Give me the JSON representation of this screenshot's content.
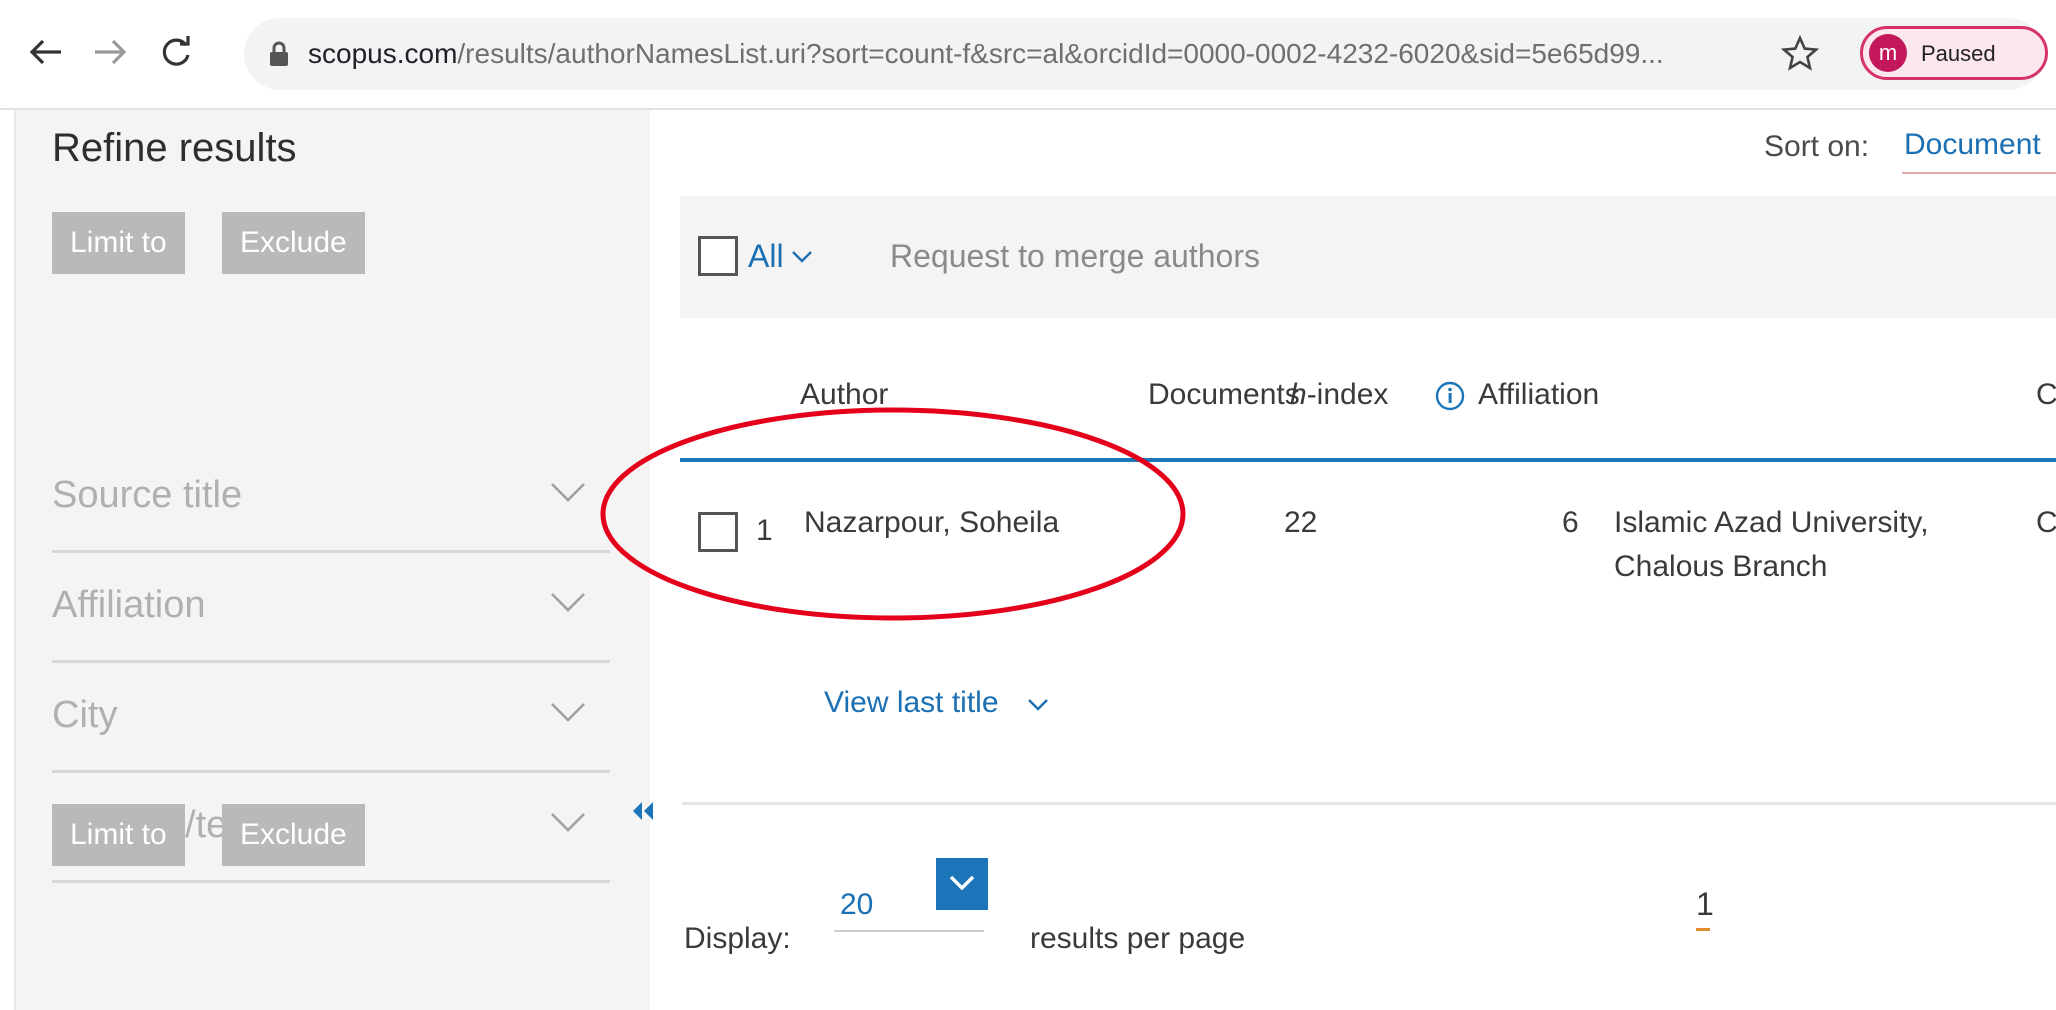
{
  "browser": {
    "url_host": "scopus.com",
    "url_path": "/results/authorNamesList.uri?sort=count-f&src=al&orcidId=0000-0002-4232-6020&sid=5e65d99...",
    "profile_initial": "m",
    "profile_status": "Paused"
  },
  "sidebar": {
    "title": "Refine results",
    "limit_label": "Limit to",
    "exclude_label": "Exclude",
    "facets": [
      "Source title",
      "Affiliation",
      "City",
      "Country/territory"
    ]
  },
  "sort": {
    "label": "Sort on:",
    "value": "Document"
  },
  "actionbar": {
    "all_label": "All",
    "merge_label": "Request to merge authors"
  },
  "table": {
    "headers": {
      "author": "Author",
      "documents": "Documents",
      "hindex_h": "h",
      "hindex_rest": "-index",
      "affiliation": "Affiliation",
      "city_partial": "C"
    },
    "rows": [
      {
        "index": "1",
        "author": "Nazarpour, Soheila",
        "documents": "22",
        "hindex": "6",
        "affiliation_line1": "Islamic Azad University,",
        "affiliation_line2": "Chalous Branch",
        "city_partial": "C"
      }
    ],
    "view_last_title": "View last title"
  },
  "pagination": {
    "display_label": "Display:",
    "per_page_value": "20",
    "per_page_suffix": "results per page",
    "current_page": "1"
  },
  "colors": {
    "link": "#1b6fb3",
    "accent_rule": "#1b75b8",
    "sidebar_button": "#b9b9b9",
    "highlight": "#e4001b"
  }
}
